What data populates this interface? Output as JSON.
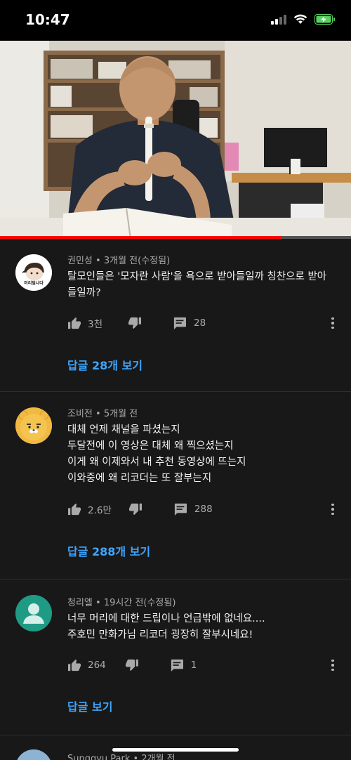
{
  "status": {
    "time": "10:47"
  },
  "video": {
    "progress_fraction": 0.8
  },
  "comments": [
    {
      "author": "권민성",
      "time": "3개월 전(수정됨)",
      "text": [
        "탈모인들은 '모자란 사람'을 욕으로 받아들일까 칭찬으로 받아",
        "들일까?"
      ],
      "likes": "3천",
      "reply_count": "28",
      "replies_label": "답글 28개 보기",
      "avatar_icon": "cartoon-avatar",
      "avatar_text": "머리털나다"
    },
    {
      "author": "조비전",
      "time": "5개월 전",
      "text": [
        "대체 언제 채널을 파셨는지",
        "두달전에 이 영상은 대체 왜 찍으셨는지",
        "이게 왜 이제와서 내 추천 동영상에 뜨는지",
        "이와중에 왜 리코더는 또 잘부는지"
      ],
      "likes": "2.6만",
      "reply_count": "288",
      "replies_label": "답글 288개 보기",
      "avatar_icon": "ryan-bear-avatar"
    },
    {
      "author": "청리엘",
      "time": "19시간 전(수정됨)",
      "text": [
        "너무 머리에 대한 드립이나 언급밖에 없네요....",
        "주호민 만화가님 리코더 굉장히 잘부시네요!"
      ],
      "likes": "264",
      "reply_count": "1",
      "replies_label": "답글 보기",
      "avatar_icon": "default-user-avatar"
    },
    {
      "author": "Sunggyu Park",
      "time": "2개월 전",
      "avatar_icon": "photo-avatar"
    }
  ],
  "icons": {
    "like": "thumbs-up-icon",
    "dislike": "thumbs-down-icon",
    "reply": "comment-icon",
    "more": "more-vertical-icon"
  },
  "colors": {
    "accent": "#3ea6ff",
    "progress": "#ff0000",
    "background": "#181818"
  }
}
